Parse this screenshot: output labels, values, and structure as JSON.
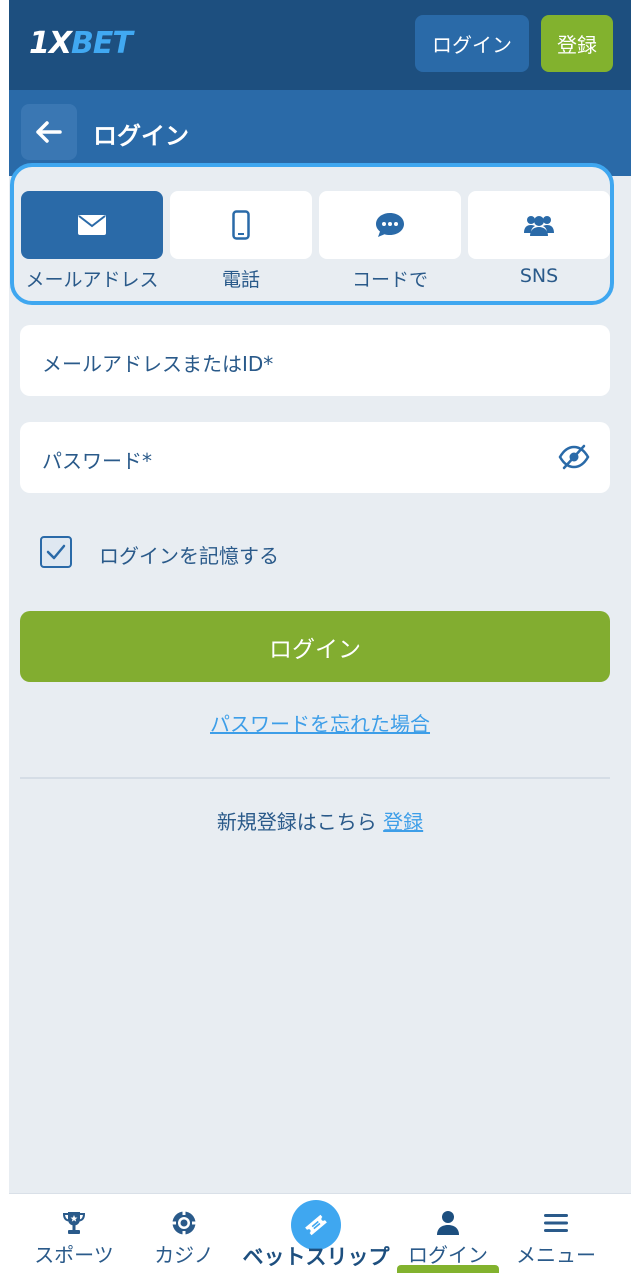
{
  "header": {
    "logo": {
      "prefix": "1X",
      "suffix": "BET"
    },
    "login_label": "ログイン",
    "register_label": "登録"
  },
  "subheader": {
    "title": "ログイン"
  },
  "login_methods": [
    {
      "label": "メールアドレス",
      "icon": "envelope-icon",
      "active": true
    },
    {
      "label": "電話",
      "icon": "phone-icon",
      "active": false
    },
    {
      "label": "コードで",
      "icon": "chat-bubble-icon",
      "active": false
    },
    {
      "label": "SNS",
      "icon": "users-icon",
      "active": false
    }
  ],
  "form": {
    "email_placeholder": "メールアドレスまたはID*",
    "password_placeholder": "パスワード*",
    "remember_label": "ログインを記憶する",
    "remember_checked": true,
    "submit_label": "ログイン",
    "forgot_label": "パスワードを忘れた場合",
    "signup_text": "新規登録はこちら",
    "signup_link": "登録"
  },
  "bottom_nav": [
    {
      "label": "スポーツ",
      "icon": "trophy-icon"
    },
    {
      "label": "カジノ",
      "icon": "casino-chip-icon"
    },
    {
      "label": "ベットスリップ",
      "icon": "ticket-icon"
    },
    {
      "label": "ログイン",
      "icon": "user-icon",
      "active": true
    },
    {
      "label": "メニュー",
      "icon": "hamburger-menu-icon"
    }
  ],
  "colors": {
    "header_bg": "#1d4f7f",
    "subheader_bg": "#2a6aa8",
    "accent_green": "#82ad30",
    "accent_blue": "#3fa7f0",
    "page_bg": "#e8edf2"
  }
}
